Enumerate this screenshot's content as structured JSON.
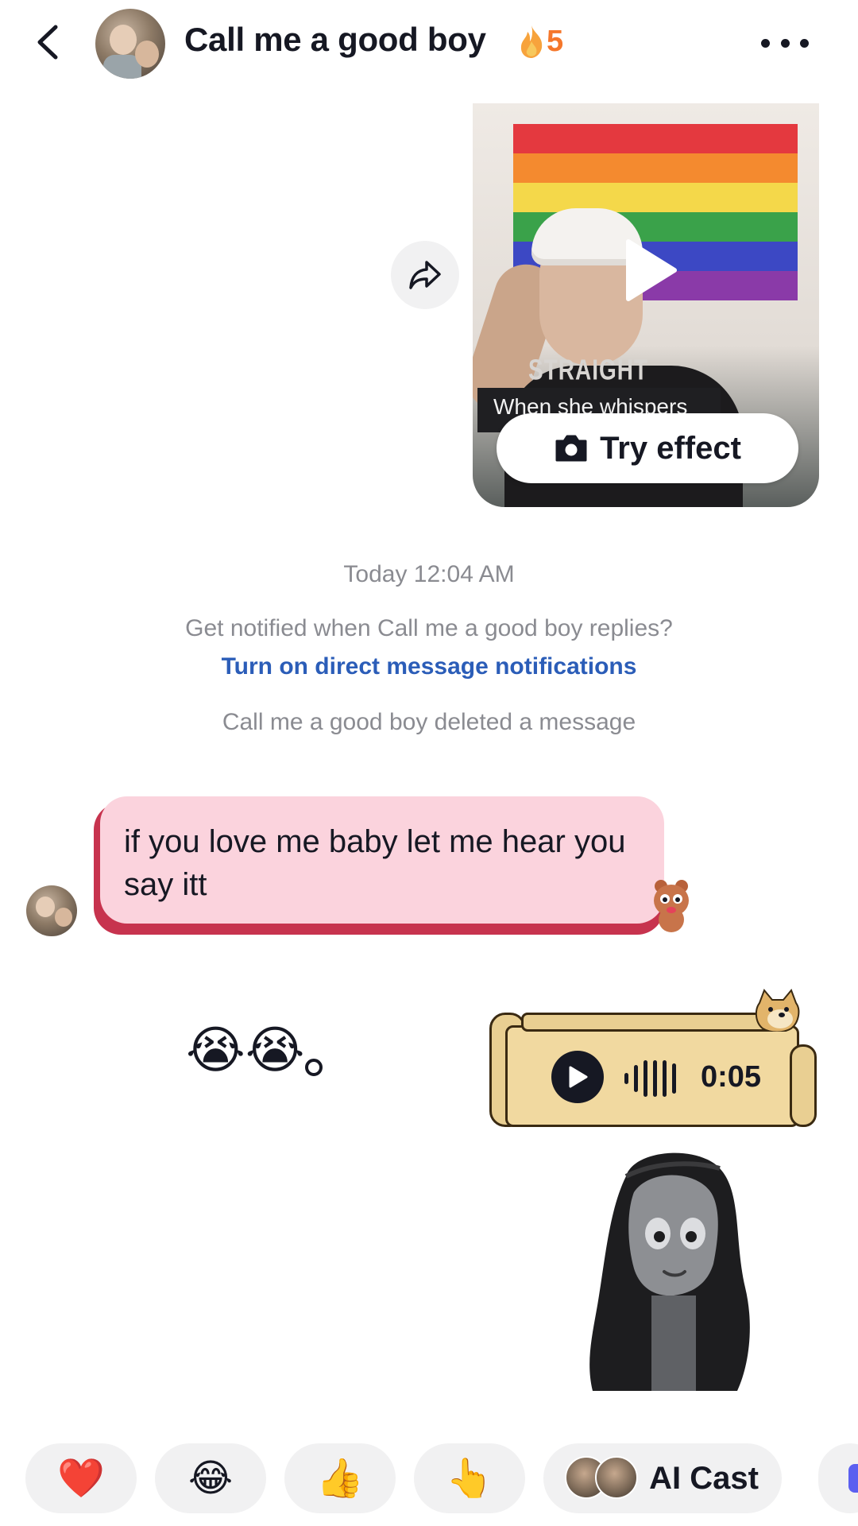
{
  "header": {
    "title": "Call me a good boy",
    "streak_count": "5"
  },
  "video": {
    "caption": "When she whispers",
    "try_effect_label": "Try effect"
  },
  "system": {
    "timestamp": "Today 12:04 AM",
    "notify_question": "Get notified when Call me a good boy replies?",
    "notify_link": "Turn on direct message notifications",
    "deleted_notice": "Call me a good boy deleted a message"
  },
  "messages": {
    "incoming_text": "if you love me baby let me hear you say itt",
    "outgoing_emoji": "😭😭",
    "voice_duration": "0:05"
  },
  "reactions": {
    "items": [
      "❤️",
      "😂",
      "👍",
      "👆"
    ],
    "ai_cast_label": "AI Cast"
  },
  "colors": {
    "accent_link": "#2b5db8",
    "streak": "#f5772b",
    "incoming_bubble": "#fbd3dd",
    "incoming_bubble_border": "#c7334e"
  }
}
